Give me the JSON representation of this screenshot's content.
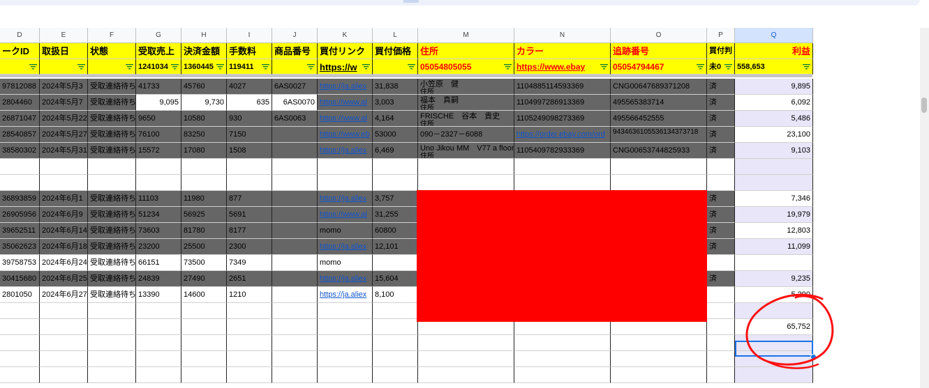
{
  "columns": [
    "D",
    "E",
    "F",
    "G",
    "H",
    "I",
    "J",
    "K",
    "L",
    "M",
    "N",
    "O",
    "P",
    "Q"
  ],
  "header_titles": {
    "D": "ークID",
    "E": "取扱日",
    "F": "状態",
    "G": "受取売上",
    "H": "決済金額",
    "I": "手数料",
    "J": "商品番号",
    "K": "買付リンク",
    "L": "買付価格",
    "M": "住所",
    "N": "カラー",
    "O": "追跡番号",
    "P": "買付判",
    "Q": "利益"
  },
  "filter_values": {
    "D": "",
    "E": "",
    "F": "",
    "G": "1241034",
    "H": "1360445",
    "I": "119411",
    "J": "",
    "K": "https://w",
    "L": "",
    "M": "05054805055",
    "N": "https://www.ebay",
    "O": "05054794467",
    "P": "未0",
    "Q": "558,653"
  },
  "rows": [
    {
      "D": "97812088",
      "E": "2024年5月3",
      "F": "受取連絡待ち",
      "G": "41733",
      "H": "45760",
      "I": "4027",
      "J": "6AS0027",
      "K": "https://ja.aliex",
      "L": "31,838",
      "M": "小笠原　健",
      "M2": "住所",
      "N": "1104885114593369",
      "O": "CNG00647689371208",
      "P": "済",
      "Q": "9,895"
    },
    {
      "D": "2804460",
      "E": "2024年5月7",
      "F": "受取連絡待ち",
      "G": "9,095",
      "H": "9,730",
      "I": "635",
      "J": "6AS0070",
      "K": "https://www.al",
      "L": "3,003",
      "M": "福本　真嗣",
      "M2": "住所",
      "N": "1104997286913369",
      "O": "495565383714",
      "P": "済",
      "Q": "6,092"
    },
    {
      "D": "26871047",
      "E": "2024年5月22",
      "F": "受取連絡待ち",
      "G": "9650",
      "H": "10580",
      "I": "930",
      "J": "6AS0063",
      "K": "https://www.al",
      "L": "4,164",
      "M": "FRISCHE　谷本　貴史",
      "M2": "住所",
      "N": "1105249098273369",
      "O": "495566452555",
      "P": "済",
      "Q": "5,486"
    },
    {
      "D": "28540857",
      "E": "2024年5月27",
      "F": "受取連絡待ち",
      "G": "76100",
      "H": "83250",
      "I": "7150",
      "J": "",
      "K": "https://www.eb",
      "L": "53000",
      "M": "090－2327－6088",
      "M2": "",
      "N": "https://order.ebay.com/ord",
      "O": "9434636105536134373718",
      "P": "済",
      "Q": "23,100"
    },
    {
      "D": "38580302",
      "E": "2024年5月31",
      "F": "受取連絡待ち",
      "G": "15572",
      "H": "17080",
      "I": "1508",
      "J": "",
      "K": "https://ja.aliex",
      "L": "6,469",
      "M": "Uno Jikou MM　V77 a floor",
      "M2": "住所",
      "N": "1105409782933369",
      "O": "CNG00653744825933",
      "P": "済",
      "Q": "9,103"
    },
    {
      "blank": true
    },
    {
      "blank": true
    },
    {
      "D": "36893859",
      "E": "2024年6月1",
      "F": "受取連絡待ち",
      "G": "11103",
      "H": "11980",
      "I": "877",
      "J": "",
      "K": "https://ja.aliex",
      "L": "3,757",
      "P": "済",
      "Q": "7,346"
    },
    {
      "D": "26905956",
      "E": "2024年6月9",
      "F": "受取連絡待ち",
      "G": "51234",
      "H": "56925",
      "I": "5691",
      "J": "",
      "K": "https://www.al",
      "L": "31,255",
      "P": "済",
      "Q": "19,979"
    },
    {
      "D": "39652511",
      "E": "2024年6月14",
      "F": "受取連絡待ち",
      "G": "73603",
      "H": "81780",
      "I": "8177",
      "J": "",
      "K": "momo",
      "L": "60800",
      "P": "済",
      "Q": "12,803"
    },
    {
      "D": "35062623",
      "E": "2024年6月18",
      "F": "受取連絡待ち",
      "G": "23200",
      "H": "25500",
      "I": "2300",
      "J": "",
      "K": "https://ja.aliex",
      "L": "12,101",
      "P": "済",
      "Q": "11,099"
    },
    {
      "D": "39758753",
      "E": "2024年6月24",
      "F": "受取連絡待ち",
      "G": "66151",
      "H": "73500",
      "I": "7349",
      "J": "",
      "K": "momo",
      "L": "",
      "P": "",
      "Q": ""
    },
    {
      "D": "30415680",
      "E": "2024年6月25",
      "F": "受取連絡待ち",
      "G": "24839",
      "H": "27490",
      "I": "2651",
      "J": "",
      "K": "https://ja.aliex",
      "L": "15,604",
      "P": "済",
      "Q": "9,235"
    },
    {
      "D": "2801050",
      "E": "2024年6月27",
      "F": "受取連絡待ち",
      "G": "13390",
      "H": "14600",
      "I": "1210",
      "J": "",
      "K": "https://ja.aliex",
      "L": "8,100",
      "P": "",
      "Q": "5,290"
    },
    {
      "blank": true
    },
    {
      "total": "65,752"
    },
    {
      "blank": true
    },
    {
      "blank": true
    },
    {
      "blank": true
    }
  ],
  "colors": {
    "header_yellow": "#ffff00",
    "dark_row": "#666666",
    "lavender": "#e8e6f8",
    "redact": "#ff0000",
    "selection": "#1a73e8"
  }
}
